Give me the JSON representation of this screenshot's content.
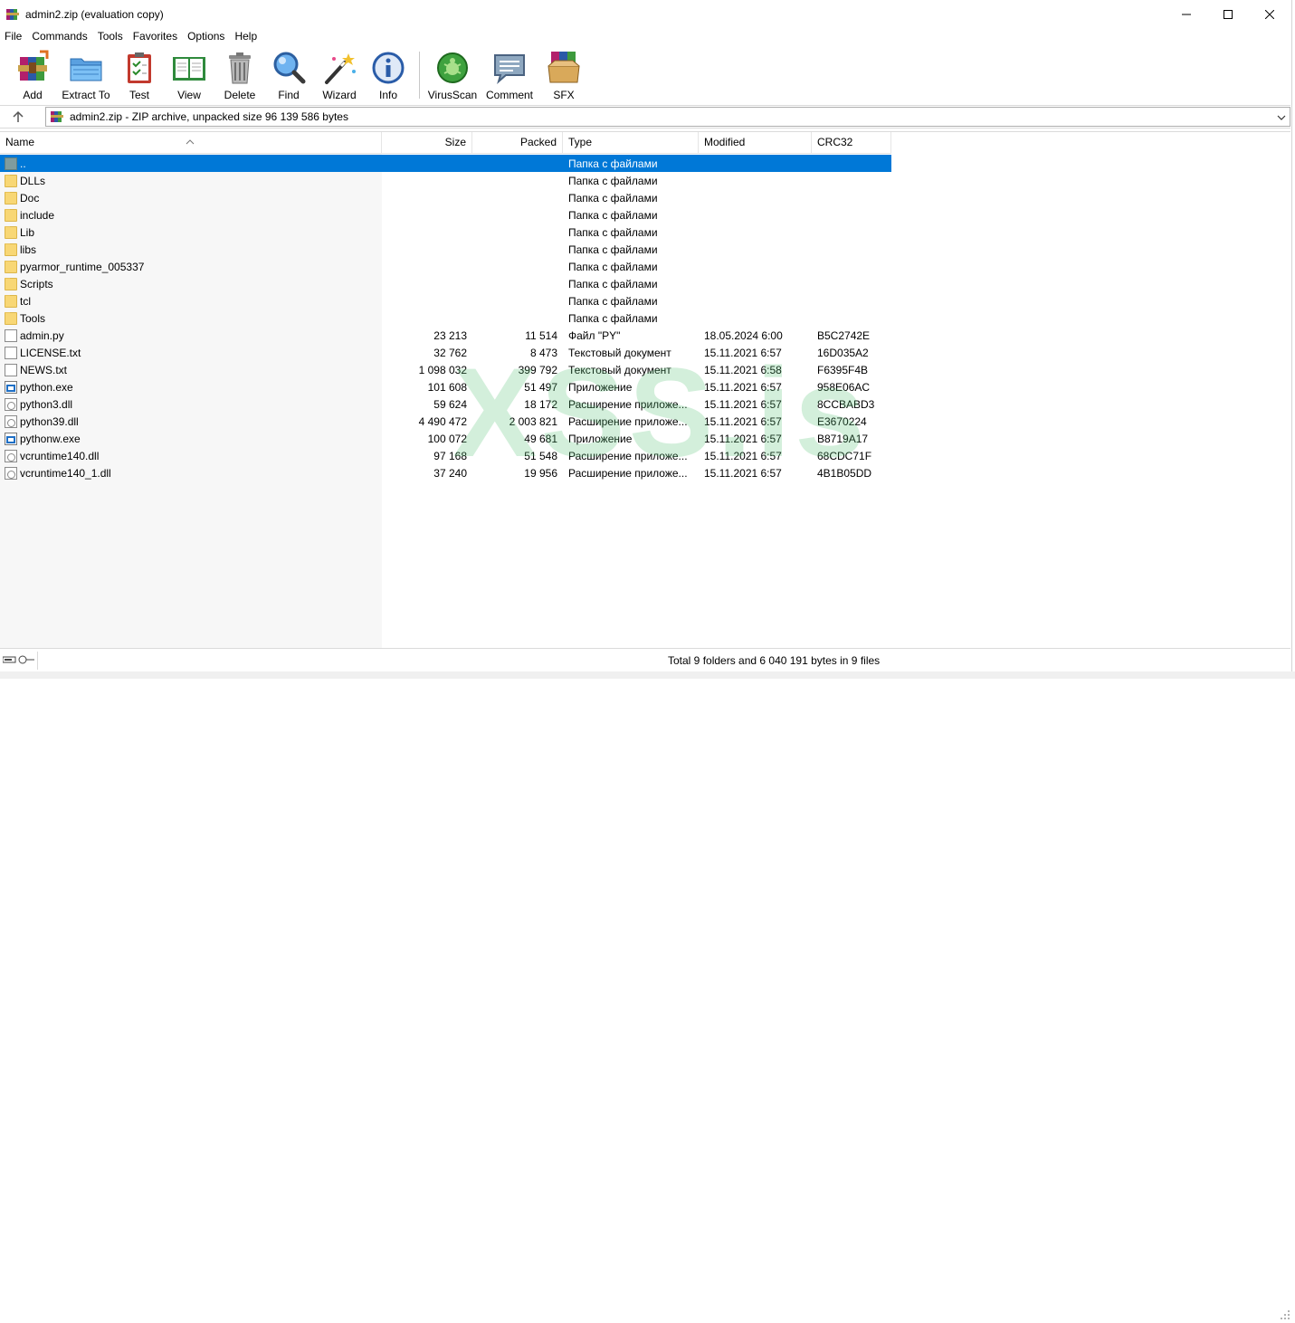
{
  "window": {
    "title": "admin2.zip (evaluation copy)",
    "icon": "winrar-books-icon"
  },
  "menu": [
    "File",
    "Commands",
    "Tools",
    "Favorites",
    "Options",
    "Help"
  ],
  "toolbar": {
    "buttons": [
      {
        "label": "Add",
        "icon": "add-archive-icon"
      },
      {
        "label": "Extract To",
        "icon": "extract-folder-icon"
      },
      {
        "label": "Test",
        "icon": "test-clipboard-icon"
      },
      {
        "label": "View",
        "icon": "view-book-icon"
      },
      {
        "label": "Delete",
        "icon": "trash-can-icon"
      },
      {
        "label": "Find",
        "icon": "magnifier-icon"
      },
      {
        "label": "Wizard",
        "icon": "magic-wand-icon"
      },
      {
        "label": "Info",
        "icon": "info-icon"
      }
    ],
    "buttons2": [
      {
        "label": "VirusScan",
        "icon": "virus-scan-icon"
      },
      {
        "label": "Comment",
        "icon": "comment-icon"
      },
      {
        "label": "SFX",
        "icon": "sfx-box-icon"
      }
    ]
  },
  "address": {
    "text": "admin2.zip - ZIP archive, unpacked size 96 139 586 bytes"
  },
  "columns": {
    "name": "Name",
    "size": "Size",
    "packed": "Packed",
    "type": "Type",
    "modified": "Modified",
    "crc": "CRC32"
  },
  "files": [
    {
      "name": "..",
      "kind": "up",
      "size": "",
      "packed": "",
      "type": "Папка с файлами",
      "modified": "",
      "crc": "",
      "selected": true
    },
    {
      "name": "DLLs",
      "kind": "folder",
      "size": "",
      "packed": "",
      "type": "Папка с файлами",
      "modified": "",
      "crc": ""
    },
    {
      "name": "Doc",
      "kind": "folder",
      "size": "",
      "packed": "",
      "type": "Папка с файлами",
      "modified": "",
      "crc": ""
    },
    {
      "name": "include",
      "kind": "folder",
      "size": "",
      "packed": "",
      "type": "Папка с файлами",
      "modified": "",
      "crc": ""
    },
    {
      "name": "Lib",
      "kind": "folder",
      "size": "",
      "packed": "",
      "type": "Папка с файлами",
      "modified": "",
      "crc": ""
    },
    {
      "name": "libs",
      "kind": "folder",
      "size": "",
      "packed": "",
      "type": "Папка с файлами",
      "modified": "",
      "crc": ""
    },
    {
      "name": "pyarmor_runtime_005337",
      "kind": "folder",
      "size": "",
      "packed": "",
      "type": "Папка с файлами",
      "modified": "",
      "crc": ""
    },
    {
      "name": "Scripts",
      "kind": "folder",
      "size": "",
      "packed": "",
      "type": "Папка с файлами",
      "modified": "",
      "crc": ""
    },
    {
      "name": "tcl",
      "kind": "folder",
      "size": "",
      "packed": "",
      "type": "Папка с файлами",
      "modified": "",
      "crc": ""
    },
    {
      "name": "Tools",
      "kind": "folder",
      "size": "",
      "packed": "",
      "type": "Папка с файлами",
      "modified": "",
      "crc": ""
    },
    {
      "name": "admin.py",
      "kind": "file",
      "size": "23 213",
      "packed": "11 514",
      "type": "Файл \"PY\"",
      "modified": "18.05.2024 6:00",
      "crc": "B5C2742E"
    },
    {
      "name": "LICENSE.txt",
      "kind": "file",
      "size": "32 762",
      "packed": "8 473",
      "type": "Текстовый документ",
      "modified": "15.11.2021 6:57",
      "crc": "16D035A2"
    },
    {
      "name": "NEWS.txt",
      "kind": "file",
      "size": "1 098 032",
      "packed": "399 792",
      "type": "Текстовый документ",
      "modified": "15.11.2021 6:58",
      "crc": "F6395F4B"
    },
    {
      "name": "python.exe",
      "kind": "exe",
      "size": "101 608",
      "packed": "51 497",
      "type": "Приложение",
      "modified": "15.11.2021 6:57",
      "crc": "958E06AC"
    },
    {
      "name": "python3.dll",
      "kind": "dll",
      "size": "59 624",
      "packed": "18 172",
      "type": "Расширение приложе...",
      "modified": "15.11.2021 6:57",
      "crc": "8CCBABD3"
    },
    {
      "name": "python39.dll",
      "kind": "dll",
      "size": "4 490 472",
      "packed": "2 003 821",
      "type": "Расширение приложе...",
      "modified": "15.11.2021 6:57",
      "crc": "E3670224"
    },
    {
      "name": "pythonw.exe",
      "kind": "exe",
      "size": "100 072",
      "packed": "49 681",
      "type": "Приложение",
      "modified": "15.11.2021 6:57",
      "crc": "B8719A17"
    },
    {
      "name": "vcruntime140.dll",
      "kind": "dll",
      "size": "97 168",
      "packed": "51 548",
      "type": "Расширение приложе...",
      "modified": "15.11.2021 6:57",
      "crc": "68CDC71F"
    },
    {
      "name": "vcruntime140_1.dll",
      "kind": "dll",
      "size": "37 240",
      "packed": "19 956",
      "type": "Расширение приложе...",
      "modified": "15.11.2021 6:57",
      "crc": "4B1B05DD"
    }
  ],
  "watermark": "XSS.is",
  "status": {
    "text": "Total 9 folders and 6 040 191 bytes in 9 files"
  },
  "colors": {
    "selection": "#0078d7",
    "watermark": "#50be6e"
  }
}
